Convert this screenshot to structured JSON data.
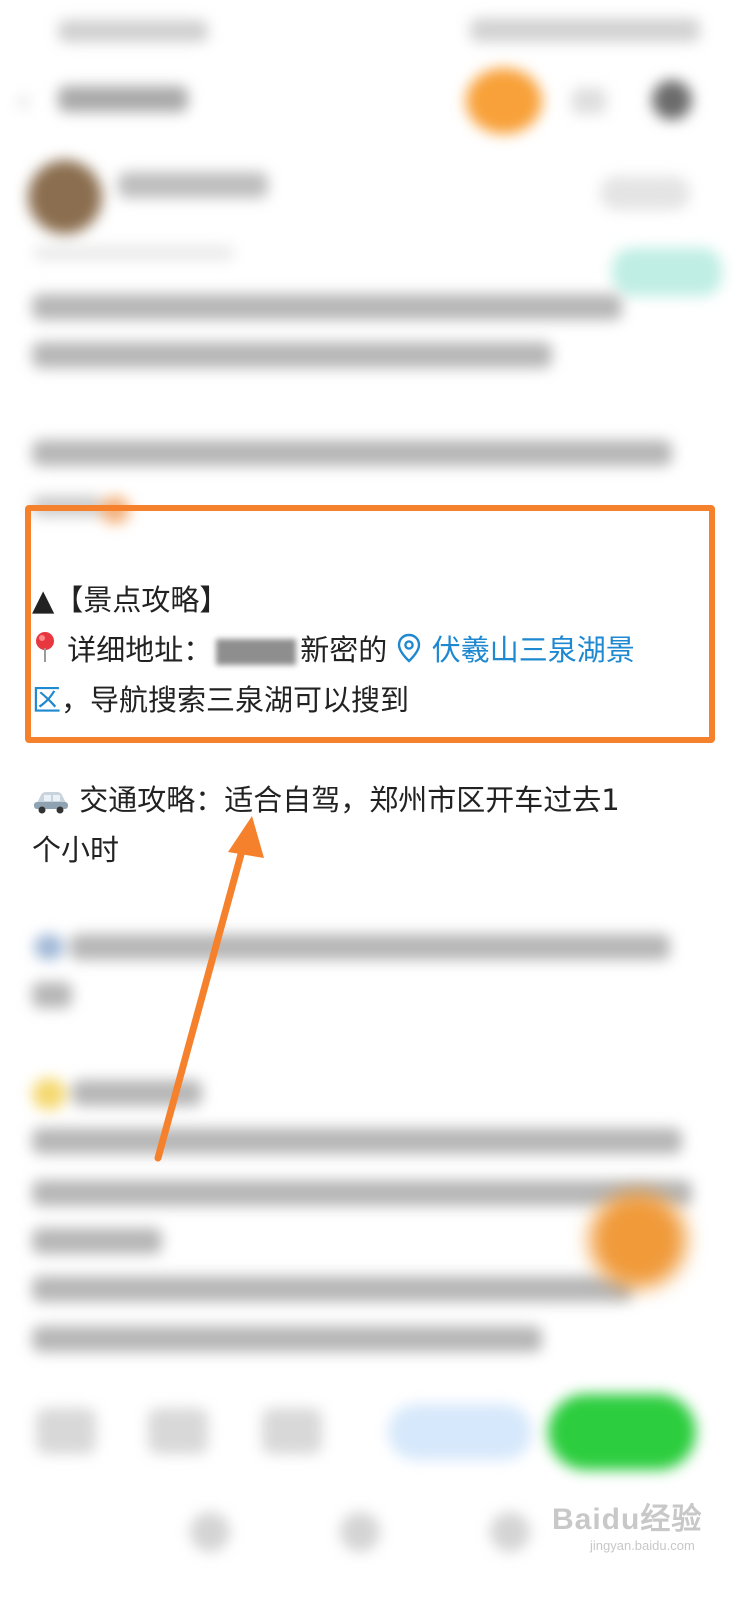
{
  "spot_guide": {
    "heading_marker": "▲",
    "heading": "【景点攻略】",
    "address_label": "详细地址：",
    "address_text_after_redaction": "新密的",
    "location_link_line1": "伏羲山三泉湖景",
    "location_link_line2": "区",
    "navigation_hint": "，导航搜索三泉湖可以搜到"
  },
  "traffic": {
    "label": "交通攻略：",
    "text_line1": "适合自驾，郑州市区开车过去1",
    "text_line2": "个小时"
  },
  "icons": {
    "heading": "triangle-icon",
    "address": "red-pin-icon",
    "location": "location-pin-icon",
    "traffic": "car-icon"
  },
  "colors": {
    "highlight": "#f5812c",
    "link": "#1e88d0",
    "send_button": "#2ccd3e"
  },
  "watermark": {
    "brand": "Baidu经验",
    "url": "jingyan.baidu.com"
  }
}
